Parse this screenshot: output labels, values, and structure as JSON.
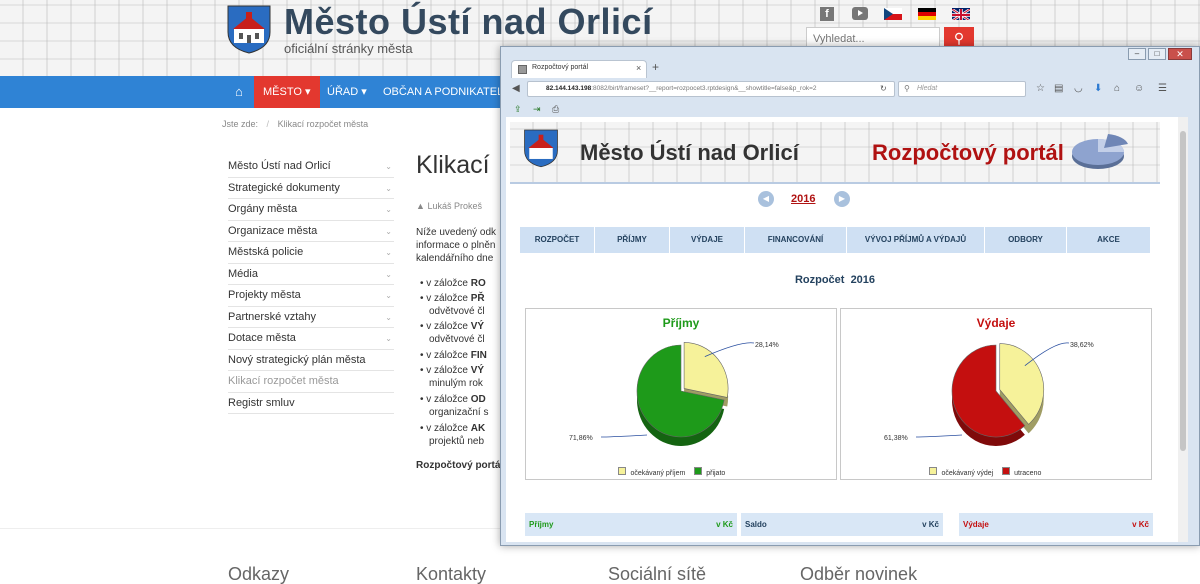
{
  "site": {
    "title": "Město Ústí nad Orlicí",
    "subtitle": "oficiální stránky města",
    "search_placeholder": "Vyhledat...",
    "nav": [
      "MĚSTO ▾",
      "ÚŘAD ▾",
      "OBČAN A PODNIKATEL ▾"
    ],
    "breadcrumb_prefix": "Jste zde:",
    "breadcrumb_current": "Klikací rozpočet města",
    "page_title": "Klikací",
    "author": "Lukáš Prokeš",
    "intro": [
      "Níže uvedený odk",
      "informace o plněn",
      "kalendářního dne"
    ],
    "bullets": [
      {
        "pre": "v záložce ",
        "bold": "RO",
        "rest": ""
      },
      {
        "pre": "v záložce ",
        "bold": "PŘ",
        "rest": "odvětvové čl"
      },
      {
        "pre": "v záložce ",
        "bold": "VÝ",
        "rest": "odvětvové čl"
      },
      {
        "pre": "v záložce ",
        "bold": "FIN",
        "rest": ""
      },
      {
        "pre": "v záložce ",
        "bold": "VÝ",
        "rest": "minulým rok"
      },
      {
        "pre": "v záložce ",
        "bold": "OD",
        "rest": "organizační s"
      },
      {
        "pre": "v záložce ",
        "bold": "AK",
        "rest": "projektů neb"
      }
    ],
    "portal_line": "Rozpočtový portá",
    "sidebar": [
      "Město Ústí nad Orlicí",
      "Strategické dokumenty",
      "Orgány města",
      "Organizace města",
      "Městská policie",
      "Média",
      "Projekty města",
      "Partnerské vztahy",
      "Dotace města",
      "Nový strategický plán města",
      "Klikací rozpočet města",
      "Registr smluv"
    ],
    "footer": [
      "Odkazy",
      "Kontakty",
      "Sociální sítě",
      "Odběr novinek"
    ]
  },
  "browser": {
    "tab_title": "Rozpočtový portál",
    "url_host": "82.144.143.198",
    "url_rest": ":8082/birt/frameset?__report=rozpocet3.rptdesign&__showtitle=false&p_rok=2",
    "search_placeholder": "Hledat"
  },
  "portal": {
    "city": "Město Ústí nad Orlicí",
    "title": "Rozpočtový portál",
    "year": "2016",
    "tabs": [
      "ROZPOČET",
      "PŘÍJMY",
      "VÝDAJE",
      "FINANCOVÁNÍ",
      "VÝVOJ PŘÍJMŮ A VÝDAJŮ",
      "ODBORY",
      "AKCE"
    ],
    "heading": "Rozpočet  2016",
    "bottom_bar": [
      {
        "label": "Příjmy",
        "unit": "v Kč"
      },
      {
        "label": "Saldo",
        "unit": "v Kč"
      },
      {
        "label": "Výdaje",
        "unit": "v Kč"
      }
    ]
  },
  "chart_data": [
    {
      "type": "pie",
      "title": "Příjmy",
      "labels": [
        "očekávaný příjem",
        "přijato"
      ],
      "values": [
        28.14,
        71.86
      ],
      "value_labels": [
        "28,14%",
        "71,86%"
      ],
      "colors": [
        "#f6f29a",
        "#1e9a1a"
      ]
    },
    {
      "type": "pie",
      "title": "Výdaje",
      "labels": [
        "očekávaný výdej",
        "utraceno"
      ],
      "values": [
        38.62,
        61.38
      ],
      "value_labels": [
        "38,62%",
        "61,38%"
      ],
      "colors": [
        "#f6f29a",
        "#c40f0f"
      ]
    }
  ],
  "colors": {
    "nav_blue": "#2f83d5",
    "accent_red": "#e3382f",
    "portal_red": "#b01212",
    "prijmy_green": "#1e9a1a"
  }
}
